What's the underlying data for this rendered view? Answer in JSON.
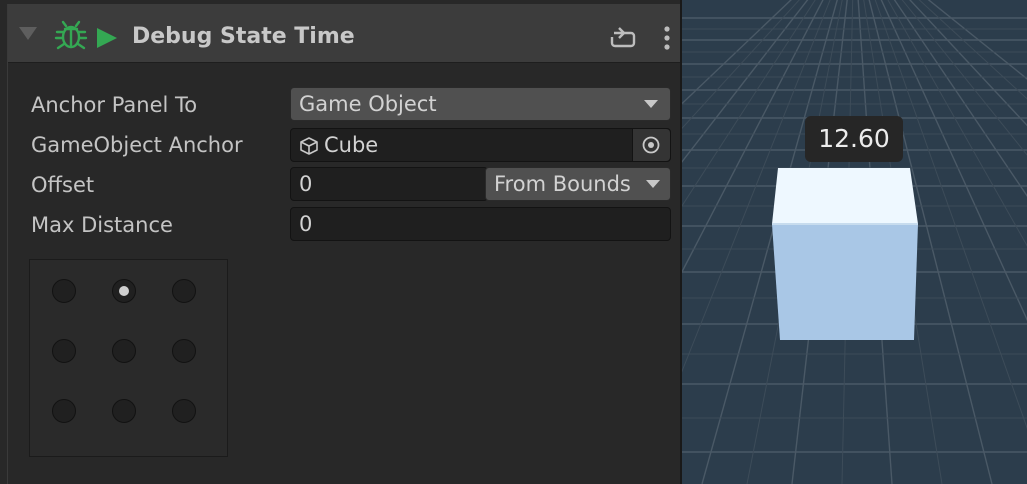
{
  "component": {
    "title": "Debug State Time",
    "enabled": true
  },
  "fields": {
    "anchor_panel_to": {
      "label": "Anchor Panel To",
      "value": "Game Object"
    },
    "gameobject_anchor": {
      "label": "GameObject Anchor",
      "value": "Cube"
    },
    "offset": {
      "label": "Offset",
      "value": "0",
      "mode": "From Bounds"
    },
    "max_distance": {
      "label": "Max Distance",
      "value": "0"
    }
  },
  "anchor_grid": {
    "selected": "top-center",
    "positions": [
      "top-left",
      "top-center",
      "top-right",
      "middle-left",
      "middle-center",
      "middle-right",
      "bottom-left",
      "bottom-center",
      "bottom-right"
    ]
  },
  "scene": {
    "label_value": "12.60"
  },
  "colors": {
    "accent_green": "#34a853",
    "panel_bg": "#282828",
    "header_bg": "#3c3c3c",
    "scene_bg": "#2c3d4c"
  },
  "icons": [
    "bug-icon",
    "play-icon",
    "reset-icon",
    "kebab-menu-icon",
    "cube-icon",
    "object-picker-icon",
    "dropdown-arrow-icon"
  ]
}
